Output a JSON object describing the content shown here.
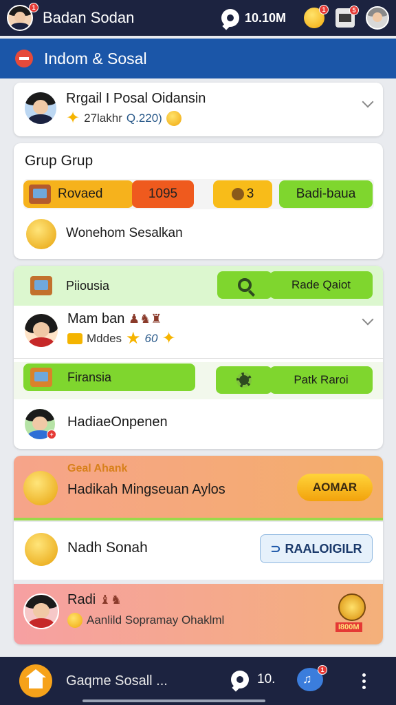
{
  "topbar": {
    "username": "Badan Sodan",
    "avatar_badge": "1",
    "chat_count": "10.10M",
    "coin_badge": "1",
    "gift_badge": "5"
  },
  "section": {
    "title": "Indom & Sosal"
  },
  "profile_card": {
    "name": "Rrgail I Posal Oidansin",
    "sub_text": "27lakhr",
    "sub_value": "Q.220)"
  },
  "group_card": {
    "title": "Grup Grup",
    "stat_label": "Rovaed",
    "stat_value": "1095",
    "count_value": "3",
    "badge_label": "Badi-baua",
    "reward_text": "Wonehom Sesalkan"
  },
  "green_card": {
    "row1_label": "Piiousia",
    "row1_button": "Rade Qaiot",
    "member_name": "Mam ban",
    "member_sub": "Mddes",
    "member_value": "60",
    "row2_label": "Firansia",
    "row2_button": "Patk Raroi",
    "member2_name": "HadiaeOnpenen"
  },
  "promo_card": {
    "tag": "Geal Ahank",
    "headline": "Hadikah Mingseuan Aylos",
    "button": "AOMAR",
    "row2_text": "Nadh Sonah",
    "row2_button": "RAALOIGILR",
    "row3_name": "Radi",
    "row3_sub": "Aanlild Sopramay Ohaklml",
    "row3_badge": "I800M"
  },
  "bottom_nav": {
    "label": "Gaqme Sosall ...",
    "chat_count": "10.",
    "badge": "1"
  },
  "colors": {
    "topbar": "#1c2340",
    "section": "#1b56a8",
    "orange": "#f6a21a",
    "green": "#7fd62e",
    "red_orange": "#ef5a1e"
  }
}
